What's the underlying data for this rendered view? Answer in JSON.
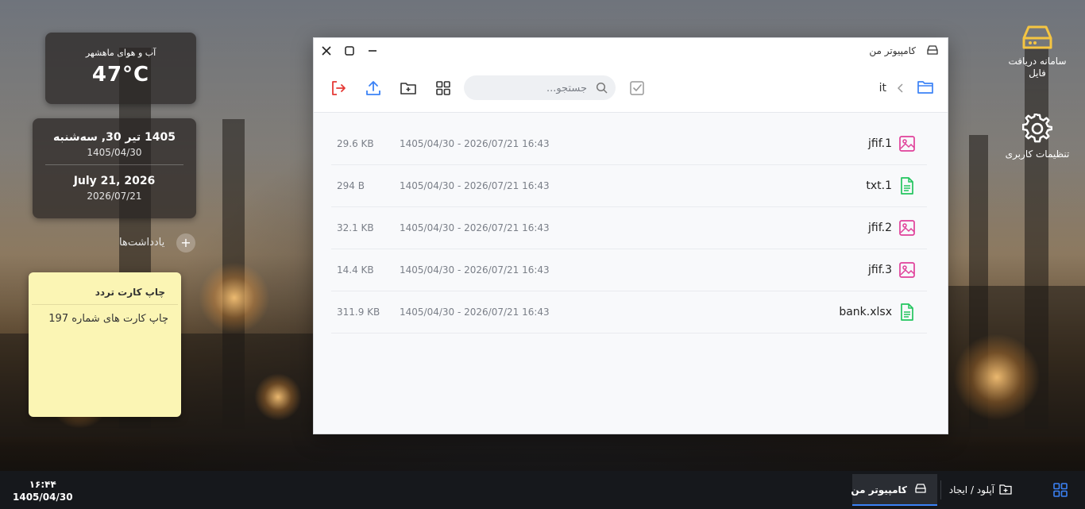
{
  "weather": {
    "label": "آب و هوای ماهشهر",
    "temperature": "47°C"
  },
  "date_widget": {
    "persian_long": "1405 تیر 30, سه‌شنبه",
    "persian_short": "1405/04/30",
    "gregorian_long": "July 21, 2026",
    "gregorian_short": "2026/07/21"
  },
  "notes": {
    "label": "یادداشت‌ها",
    "add": "+"
  },
  "sticky_note": {
    "title": "چاپ کارت تردد",
    "body": "چاپ کارت های شماره 197"
  },
  "desktop_icons": [
    {
      "label": "سامانه دریافت فایل",
      "icon": "hard-drive-icon"
    },
    {
      "label": "تنظیمات کاربری",
      "icon": "gear-icon"
    }
  ],
  "window": {
    "title": "کامپیوتر من",
    "search_placeholder": "جستجو...",
    "breadcrumb": {
      "current": "it"
    },
    "files": [
      {
        "name": "jfif.1",
        "type": "image",
        "date": "1405/04/30 - 2026/07/21 16:43",
        "size": "29.6 KB"
      },
      {
        "name": "txt.1",
        "type": "text",
        "date": "1405/04/30 - 2026/07/21 16:43",
        "size": "294 B"
      },
      {
        "name": "jfif.2",
        "type": "image",
        "date": "1405/04/30 - 2026/07/21 16:43",
        "size": "32.1 KB"
      },
      {
        "name": "jfif.3",
        "type": "image",
        "date": "1405/04/30 - 2026/07/21 16:43",
        "size": "14.4 KB"
      },
      {
        "name": "bank.xlsx",
        "type": "text",
        "date": "1405/04/30 - 2026/07/21 16:43",
        "size": "311.9 KB"
      }
    ]
  },
  "taskbar": {
    "time": "۱۶:۴۴",
    "date": "1405/04/30",
    "upload_label": "آپلود / ایجاد",
    "active_app": "کامپیوتر من"
  },
  "colors": {
    "accent": "#3b82f6",
    "image_icon": "#e0409a",
    "text_icon": "#22c55e",
    "logout": "#e53935",
    "desk_icon": "#f5c542"
  }
}
